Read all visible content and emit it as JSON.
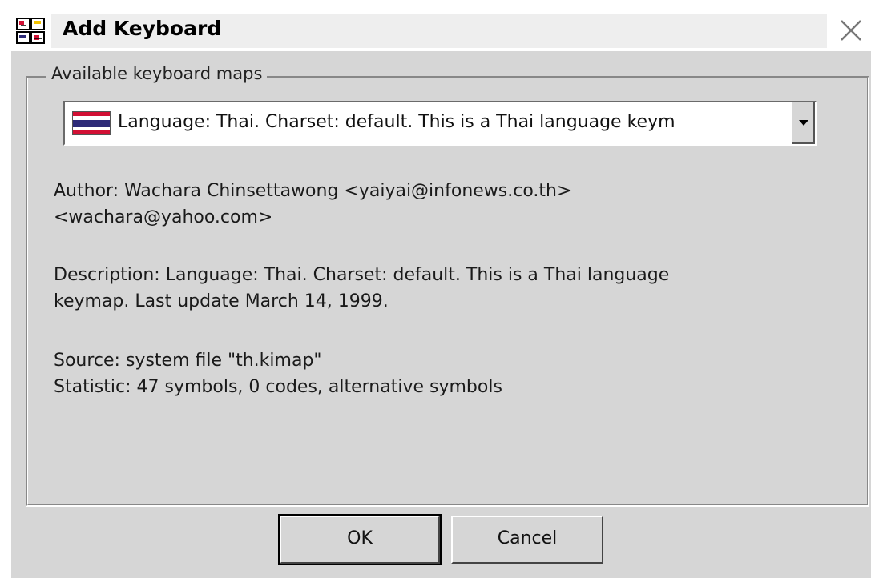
{
  "window": {
    "title": "Add Keyboard",
    "app_icon": "keyboard-app-icon",
    "close_icon": "close-icon"
  },
  "group": {
    "legend": "Available keyboard maps"
  },
  "keymap_select": {
    "flag_icon": "thailand-flag-icon",
    "selected_value": "Language: Thai. Charset: default. This is a Thai language keym"
  },
  "details": {
    "author_line1": "Author:  Wachara Chinsettawong <yaiyai@infonews.co.th>",
    "author_line2": "<wachara@yahoo.com>",
    "description_line1": "Description:  Language: Thai. Charset: default. This is a Thai language",
    "description_line2": "keymap.  Last update March 14, 1999.",
    "source": "Source:  system file \"th.kimap\"",
    "statistic": "Statistic:  47 symbols, 0 codes, alternative symbols"
  },
  "buttons": {
    "ok_label": "OK",
    "cancel_label": "Cancel"
  },
  "colors": {
    "dialog_bg": "#d6d6d6",
    "flag_red": "#d21034",
    "flag_blue": "#2d2a78",
    "flag_white": "#ffffff"
  }
}
